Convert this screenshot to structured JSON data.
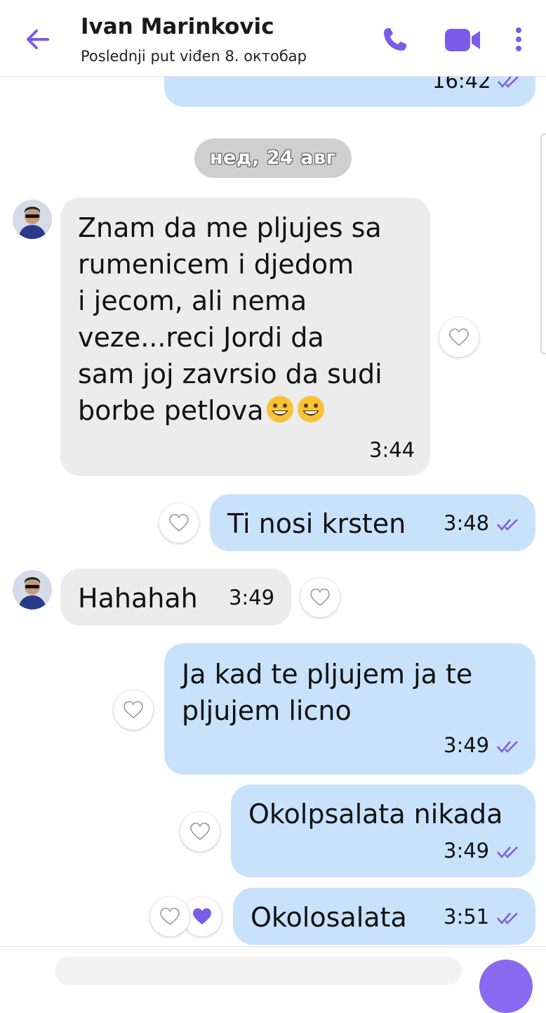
{
  "header": {
    "contact_name": "Ivan Marinkovic",
    "last_seen": "Poslednji put viđen 8. октобар",
    "accent_color": "#7b5ce6",
    "icons": [
      "back-arrow-icon",
      "phone-icon",
      "video-icon",
      "more-vertical-icon"
    ]
  },
  "messages": {
    "top_partial": {
      "time": "16:42"
    },
    "date_separator": "нед, 24 авг",
    "m1": {
      "direction": "incoming",
      "lines": [
        "Znam da me pljujes sa",
        "rumenicem i djedom",
        "i jecom, ali nema",
        "veze...reci Jordi da",
        "sam joj zavrsio da sudi",
        "borbe petlova"
      ],
      "emoji": [
        "grinning-face-emoji",
        "grinning-face-emoji"
      ],
      "time": "3:44"
    },
    "m2": {
      "direction": "outgoing",
      "text": "Ti nosi krsten",
      "time": "3:48"
    },
    "m3": {
      "direction": "incoming",
      "text": "Hahahah",
      "time": "3:49"
    },
    "m4": {
      "direction": "outgoing",
      "lines": [
        "Ja kad te pljujem ja te",
        "pljujem licno"
      ],
      "time": "3:49"
    },
    "m5": {
      "direction": "outgoing",
      "text": "Okolpsalata nikada",
      "time": "3:49"
    },
    "m6": {
      "direction": "outgoing",
      "text": "Okolosalata",
      "time": "3:51",
      "liked": true
    }
  },
  "colors": {
    "outgoing_bubble": "#c8e2fb",
    "incoming_bubble": "#ececec",
    "check_color": "#7b5ce6",
    "like_color": "#7b5ce6"
  }
}
